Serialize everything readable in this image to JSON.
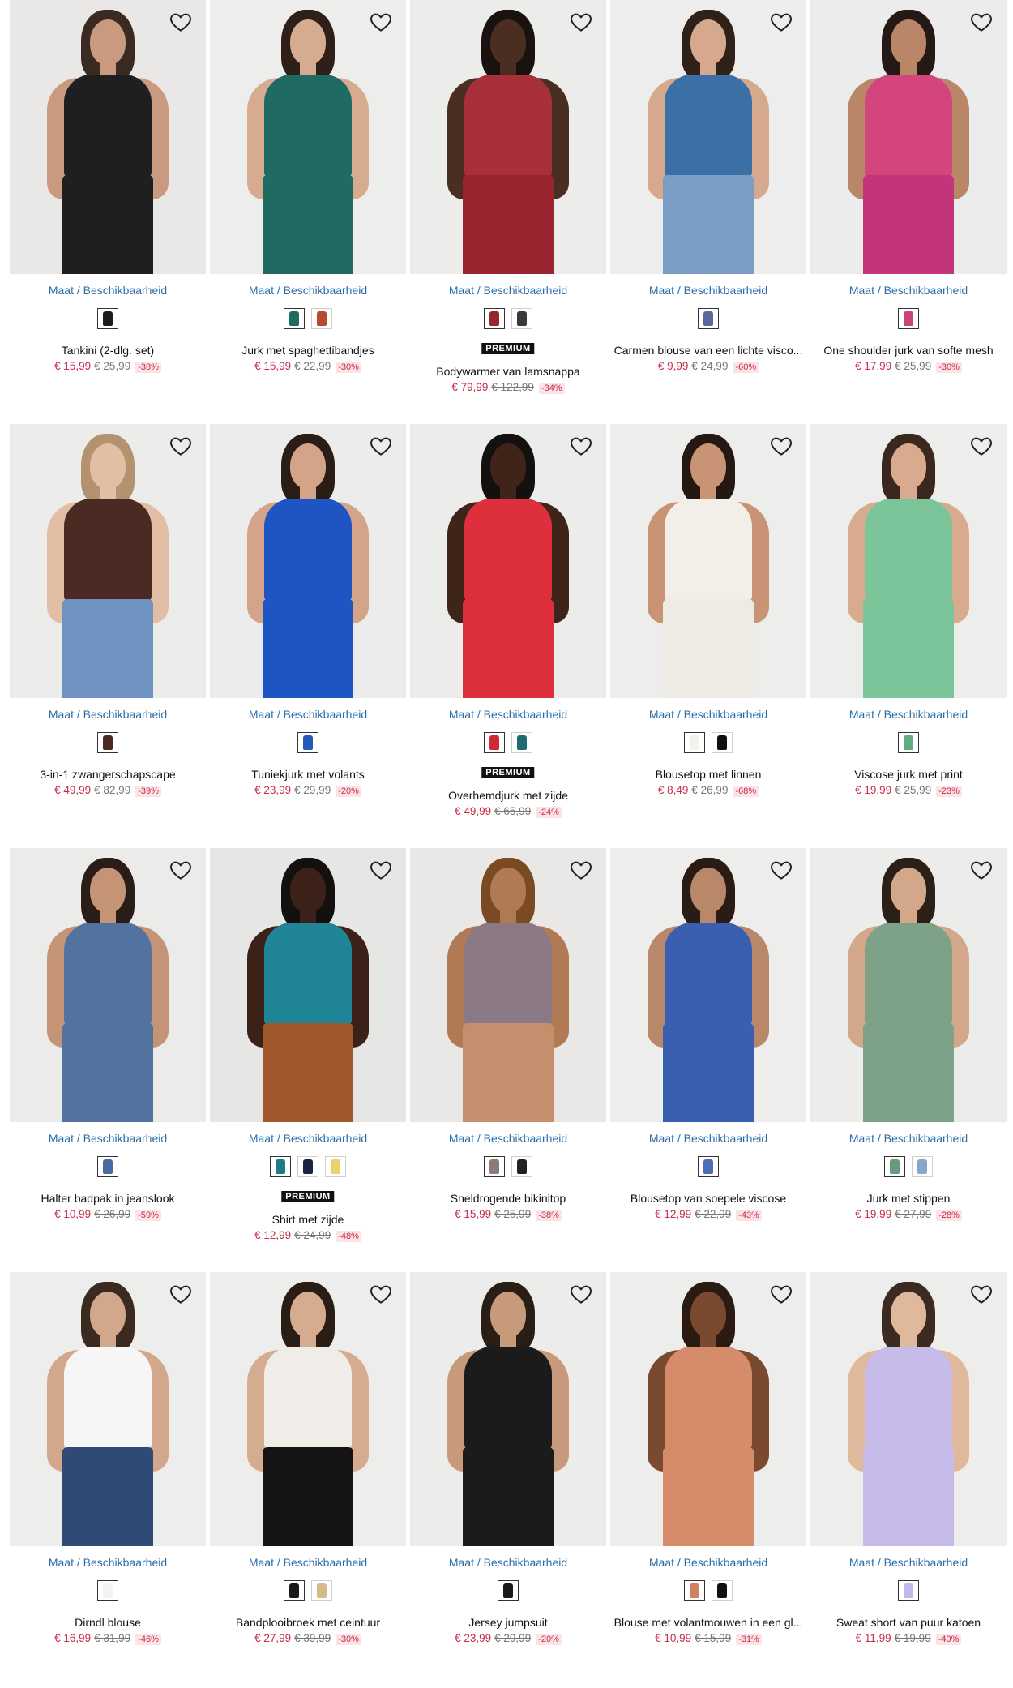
{
  "common": {
    "size_link": "Maat / Beschikbaarheid",
    "badge": "PREMIUM"
  },
  "colors": {
    "link": "#2a6ea8",
    "sale_price": "#c62d4a",
    "discount_bg": "#fbe3e6"
  },
  "products": [
    {
      "name": "Tankini (2-dlg. set)",
      "price": "€ 15,99",
      "old": "€ 25,99",
      "disc": "-38%",
      "premium": false,
      "swatches": [
        "#1d1d1d"
      ],
      "garment": "#1f1f22",
      "bottom": "#1f1f22",
      "bg": "#e9e8e6",
      "skin": "#c99a7f",
      "hair": "#3a2a22"
    },
    {
      "name": "Jurk met spaghettibandjes",
      "price": "€ 15,99",
      "old": "€ 22,99",
      "disc": "-30%",
      "premium": false,
      "swatches": [
        "#1f6b62",
        "#b64a2e"
      ],
      "garment": "#1f6b62",
      "bottom": "#1f6b62",
      "bg": "#ededec",
      "skin": "#d7ab8f",
      "hair": "#2e2019"
    },
    {
      "name": "Bodywarmer van lamsnappa",
      "price": "€ 79,99",
      "old": "€ 122,99",
      "disc": "-34%",
      "premium": true,
      "swatches": [
        "#9a2330",
        "#3a3a3a"
      ],
      "garment": "#a8303b",
      "bottom": "#9a2330",
      "bg": "#ececeb",
      "skin": "#4b2e22",
      "hair": "#191210"
    },
    {
      "name": "Carmen blouse van een lichte visco...",
      "price": "€ 9,99",
      "old": "€ 24,99",
      "disc": "-60%",
      "premium": false,
      "swatches": [
        "#5a6a9a"
      ],
      "garment": "#3c6fa6",
      "bottom": "#7a9dc4",
      "bg": "#ededed",
      "skin": "#d6a98f",
      "hair": "#2f2018"
    },
    {
      "name": "One shoulder jurk van softe mesh",
      "price": "€ 17,99",
      "old": "€ 25,99",
      "disc": "-30%",
      "premium": false,
      "swatches": [
        "#c8447a"
      ],
      "garment": "#d4457d",
      "bottom": "#c2357a",
      "bg": "#ececec",
      "skin": "#b98668",
      "hair": "#241915"
    },
    {
      "name": "3-in-1 zwangerschapscape",
      "price": "€ 49,99",
      "old": "€ 82,99",
      "disc": "-39%",
      "premium": false,
      "swatches": [
        "#4a2a22"
      ],
      "garment": "#4a2a22",
      "bottom": "#6f93c1",
      "bg": "#ececea",
      "skin": "#e2bea5",
      "hair": "#b49270"
    },
    {
      "name": "Tuniekjurk met volants",
      "price": "€ 23,99",
      "old": "€ 29,99",
      "disc": "-20%",
      "premium": false,
      "swatches": [
        "#2459b8"
      ],
      "garment": "#1f55c2",
      "bottom": "#1f55c2",
      "bg": "#ececec",
      "skin": "#d4a488",
      "hair": "#2a1d16"
    },
    {
      "name": "Overhemdjurk met zijde",
      "price": "€ 49,99",
      "old": "€ 65,99",
      "disc": "-24%",
      "premium": true,
      "swatches": [
        "#d12836",
        "#1f6b70"
      ],
      "garment": "#dd2f3c",
      "bottom": "#dd2f3c",
      "bg": "#ececeb",
      "skin": "#3f2419",
      "hair": "#151010"
    },
    {
      "name": "Blousetop met linnen",
      "price": "€ 8,49",
      "old": "€ 26,99",
      "disc": "-68%",
      "premium": false,
      "swatches": [
        "#f4f1ec",
        "#111111"
      ],
      "garment": "#f3efe8",
      "bottom": "#eeeae4",
      "bg": "#ededec",
      "skin": "#c99476",
      "hair": "#241812"
    },
    {
      "name": "Viscose jurk met print",
      "price": "€ 19,99",
      "old": "€ 25,99",
      "disc": "-23%",
      "premium": false,
      "swatches": [
        "#5fae7e"
      ],
      "garment": "#7cc49a",
      "bottom": "#7cc49a",
      "bg": "#ededec",
      "skin": "#d9ab8e",
      "hair": "#3a281e"
    },
    {
      "name": "Halter badpak in jeanslook",
      "price": "€ 10,99",
      "old": "€ 26,99",
      "disc": "-59%",
      "premium": false,
      "swatches": [
        "#4a6aa4"
      ],
      "garment": "#52729f",
      "bottom": "#52729f",
      "bg": "#ebebea",
      "skin": "#c59476",
      "hair": "#2a1c16"
    },
    {
      "name": "Shirt met zijde",
      "price": "€ 12,99",
      "old": "€ 24,99",
      "disc": "-48%",
      "premium": true,
      "swatches": [
        "#1f7a86",
        "#1d2340",
        "#e8d26a"
      ],
      "garment": "#1f8597",
      "bottom": "#a0572b",
      "bg": "#e6e6e5",
      "skin": "#3b2117",
      "hair": "#141010"
    },
    {
      "name": "Sneldrogende bikinitop",
      "price": "€ 15,99",
      "old": "€ 25,99",
      "disc": "-38%",
      "premium": false,
      "swatches": [
        "#8a7c76",
        "#222222"
      ],
      "garment": "#8b7a86",
      "bottom": "#c48f6c",
      "bg": "#e9e8e6",
      "skin": "#b07a55",
      "hair": "#7a4a22"
    },
    {
      "name": "Blousetop van soepele viscose",
      "price": "€ 12,99",
      "old": "€ 22,99",
      "disc": "-43%",
      "premium": false,
      "swatches": [
        "#4c6db8"
      ],
      "garment": "#3a5fb0",
      "bottom": "#3a5fb0",
      "bg": "#ededec",
      "skin": "#b98769",
      "hair": "#2a1c15"
    },
    {
      "name": "Jurk met stippen",
      "price": "€ 19,99",
      "old": "€ 27,99",
      "disc": "-28%",
      "premium": false,
      "swatches": [
        "#6a9a7c",
        "#8aa7c9"
      ],
      "garment": "#7da287",
      "bottom": "#7da287",
      "bg": "#ececeb",
      "skin": "#d3a78a",
      "hair": "#2c1f18"
    },
    {
      "name": "Dirndl blouse",
      "price": "€ 16,99",
      "old": "€ 31,99",
      "disc": "-46%",
      "premium": false,
      "swatches": [
        "#f3f3f3"
      ],
      "garment": "#f6f6f6",
      "bottom": "#2f4a74",
      "bg": "#ededec",
      "skin": "#d3a78c",
      "hair": "#3b2a20"
    },
    {
      "name": "Bandplooibroek met ceintuur",
      "price": "€ 27,99",
      "old": "€ 39,99",
      "disc": "-30%",
      "premium": false,
      "swatches": [
        "#1a1a1a",
        "#d8b98e"
      ],
      "garment": "#f0ede8",
      "bottom": "#141414",
      "bg": "#ededec",
      "skin": "#d6ac90",
      "hair": "#2a1d16"
    },
    {
      "name": "Jersey jumpsuit",
      "price": "€ 23,99",
      "old": "€ 29,99",
      "disc": "-20%",
      "premium": false,
      "swatches": [
        "#1a1a1a"
      ],
      "garment": "#1b1b1b",
      "bottom": "#1b1b1b",
      "bg": "#ececeb",
      "skin": "#c79a7c",
      "hair": "#2a1d16"
    },
    {
      "name": "Blouse met volantmouwen in een gl...",
      "price": "€ 10,99",
      "old": "€ 15,99",
      "disc": "-31%",
      "premium": false,
      "swatches": [
        "#cf8260",
        "#111111"
      ],
      "garment": "#d68b6a",
      "bottom": "#d68b6a",
      "bg": "#ededec",
      "skin": "#7a4a30",
      "hair": "#2a1a12"
    },
    {
      "name": "Sweat short van puur katoen",
      "price": "€ 11,99",
      "old": "€ 19,99",
      "disc": "-40%",
      "premium": false,
      "swatches": [
        "#c4b8e8"
      ],
      "garment": "#c6bbe9",
      "bottom": "#c6bbe9",
      "bg": "#ededec",
      "skin": "#e0b89c",
      "hair": "#3a2a20"
    }
  ]
}
